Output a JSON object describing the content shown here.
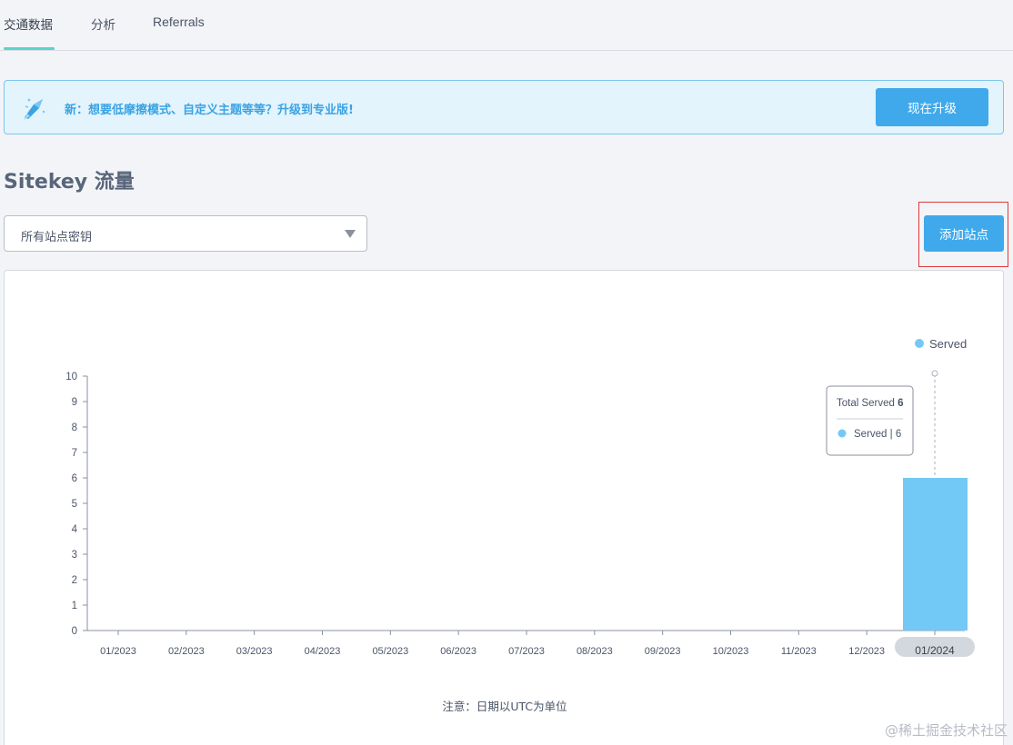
{
  "tabs": [
    {
      "label": "交通数据",
      "active": true
    },
    {
      "label": "分析",
      "active": false
    },
    {
      "label": "Referrals",
      "active": false
    }
  ],
  "banner": {
    "text": "新：想要低摩擦模式、自定义主题等等？升级到专业版!",
    "button_label": "现在升级"
  },
  "page_title": "Sitekey 流量",
  "sitekey_select": {
    "selected": "所有站点密钥"
  },
  "add_site_label": "添加站点",
  "colors": {
    "accent": "#3fa9ec",
    "bar": "#73c9f5",
    "tab_underline": "#58d3c9"
  },
  "chart_data": {
    "type": "bar",
    "categories": [
      "01/2023",
      "02/2023",
      "03/2023",
      "04/2023",
      "05/2023",
      "06/2023",
      "07/2023",
      "08/2023",
      "09/2023",
      "10/2023",
      "11/2023",
      "12/2023",
      "01/2024"
    ],
    "series": [
      {
        "name": "Served",
        "values": [
          0,
          0,
          0,
          0,
          0,
          0,
          0,
          0,
          0,
          0,
          0,
          0,
          6
        ]
      }
    ],
    "ylim": [
      0,
      10
    ],
    "yticks": [
      0,
      1,
      2,
      3,
      4,
      5,
      6,
      7,
      8,
      9,
      10
    ],
    "legend_position": "top-right",
    "grid": false,
    "highlighted_category": "01/2024",
    "tooltip": {
      "title": "Total Served",
      "total": "6",
      "series_label": "Served",
      "series_value": "6"
    }
  },
  "footnote": "注意：日期以UTC为单位",
  "watermark": "@稀土掘金技术社区"
}
